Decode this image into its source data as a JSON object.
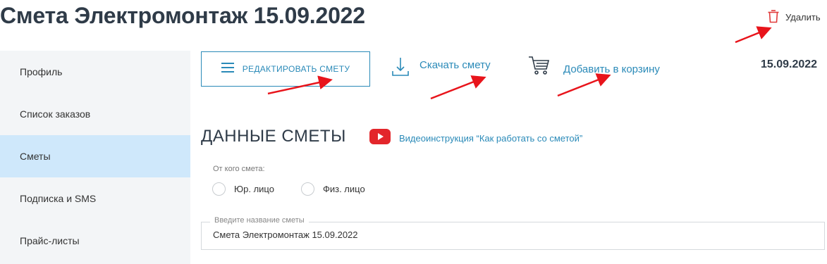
{
  "header": {
    "title": "Смета Электромонтаж 15.09.2022",
    "delete_label": "Удалить"
  },
  "sidebar": {
    "items": [
      {
        "label": "Профиль"
      },
      {
        "label": "Список заказов"
      },
      {
        "label": "Сметы",
        "active": true
      },
      {
        "label": "Подписка и SMS"
      },
      {
        "label": "Прайс-листы"
      }
    ]
  },
  "toolbar": {
    "edit_label": "РЕДАКТИРОВАТЬ СМЕТУ",
    "download_label": "Скачать смету",
    "cart_label": "Добавить в корзину",
    "date": "15.09.2022"
  },
  "section": {
    "title": "ДАННЫЕ СМЕТЫ",
    "video_label": "Видеоинструкция “Как работать со сметой”"
  },
  "form": {
    "from_label": "От кого смета:",
    "radio_options": [
      "Юр. лицо",
      "Физ. лицо"
    ],
    "name_legend": "Введите название сметы",
    "name_value": "Смета Электромонтаж 15.09.2022"
  },
  "icons": {
    "delete": "trash-icon",
    "edit": "hamburger-menu-icon",
    "download": "download-icon",
    "cart": "shopping-cart-icon",
    "video": "youtube-icon"
  },
  "colors": {
    "accent": "#2a8ab8",
    "title": "#2f3b48",
    "sidebar_bg": "#f3f5f7",
    "sidebar_active": "#cfe8fb",
    "delete_icon": "#e03a3a",
    "video_icon": "#e3262b",
    "annotation_arrow": "#e8141b"
  }
}
